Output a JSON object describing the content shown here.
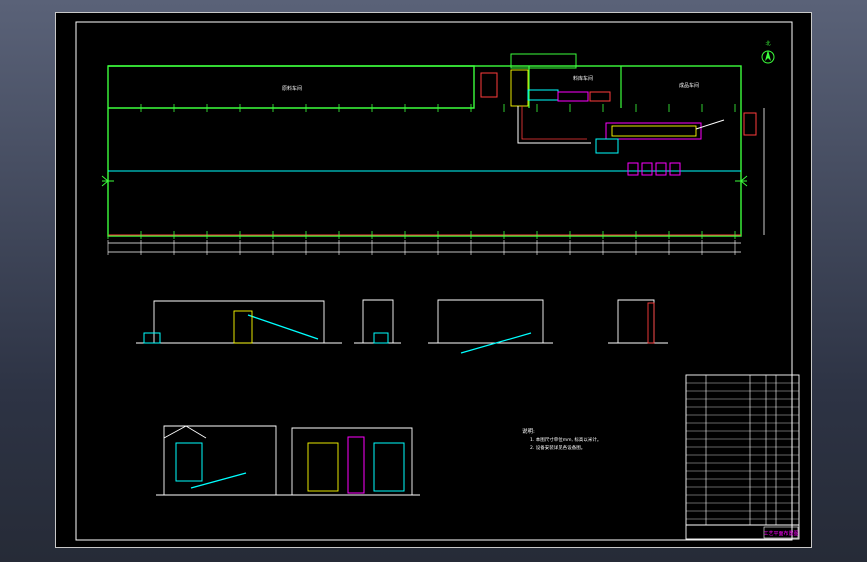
{
  "drawing": {
    "north_label": "北",
    "areas": [
      {
        "label": "原料车间"
      },
      {
        "label": "料库车间"
      },
      {
        "label": "成品车间"
      }
    ],
    "notes_title": "说明:",
    "notes": [
      "1. 本图尺寸单位mm, 标高以米计。",
      "2. 设备安装详见各设备图。"
    ],
    "title_block": {
      "drawing_title": "工艺平面布置图"
    }
  },
  "colors": {
    "background": "#000000",
    "outline": "#ffffff",
    "building": "#3cff3c",
    "axis": "#ffffff",
    "centerline": "#ff3c3c",
    "equipment_cyan": "#00ffff",
    "equipment_magenta": "#ff00ff",
    "equipment_yellow": "#ffff00"
  }
}
